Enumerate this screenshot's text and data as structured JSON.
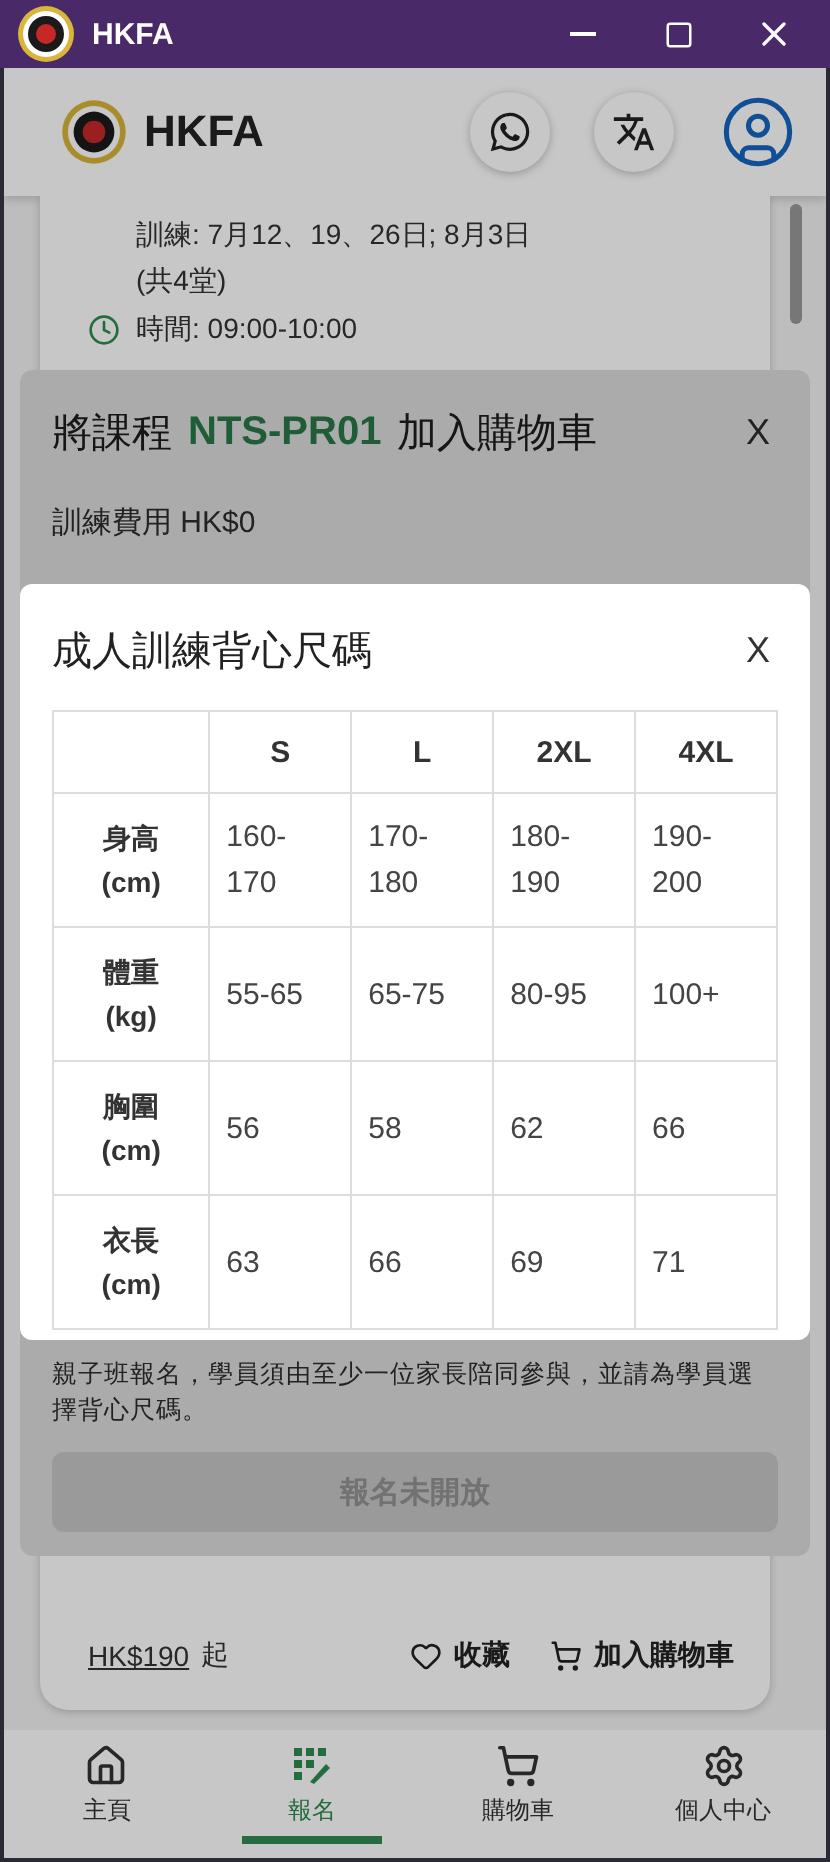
{
  "window": {
    "title": "HKFA"
  },
  "header": {
    "brand": "HKFA"
  },
  "course_card": {
    "schedule_lines": [
      "訓練: 7月12、19、26日; 8月3日",
      "(共4堂)"
    ],
    "time": "時間: 09:00-10:00",
    "price": "HK$190",
    "price_suffix": "起",
    "favourite": "收藏",
    "add_to_cart": "加入購物車"
  },
  "cart_dialog": {
    "title_prefix": "將課程",
    "course_code": "NTS-PR01",
    "title_suffix": "加入購物車",
    "close": "X",
    "fee": "訓練費用 HK$0",
    "note": "親子班報名，學員須由至少一位家長陪同參與，並請為學員選擇背心尺碼。",
    "enroll_button": {
      "label": "報名未開放",
      "disabled": true
    }
  },
  "size_dialog": {
    "title": "成人訓練背心尺碼",
    "close": "X",
    "table": {
      "columns": [
        "S",
        "L",
        "2XL",
        "4XL"
      ],
      "rows": [
        {
          "label": "身高\n(cm)",
          "cells": [
            "160-170",
            "170-180",
            "180-190",
            "190-200"
          ]
        },
        {
          "label": "體重\n(kg)",
          "cells": [
            "55-65",
            "65-75",
            "80-95",
            "100+"
          ]
        },
        {
          "label": "胸圍\n(cm)",
          "cells": [
            "56",
            "58",
            "62",
            "66"
          ]
        },
        {
          "label": "衣長\n(cm)",
          "cells": [
            "63",
            "66",
            "69",
            "71"
          ]
        }
      ]
    }
  },
  "bottom_nav": [
    {
      "kind": "home",
      "label": "主頁",
      "selected": false
    },
    {
      "kind": "enrol",
      "label": "報名",
      "selected": true
    },
    {
      "kind": "cart",
      "label": "購物車",
      "selected": false
    },
    {
      "kind": "settings",
      "label": "個人中心",
      "selected": false
    }
  ]
}
